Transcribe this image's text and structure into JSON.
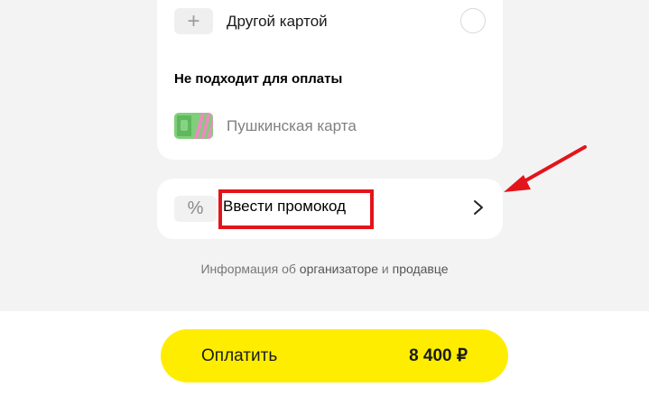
{
  "payment_methods": {
    "other_card_label": "Другой картой",
    "add_symbol": "+",
    "not_suitable_title": "Не подходит для оплаты",
    "pushkin_card_label": "Пушкинская карта"
  },
  "promo": {
    "icon_symbol": "%",
    "label": "Ввести промокод"
  },
  "info": {
    "prefix": "Информация об ",
    "organizer_link": "организаторе",
    "middle": " и ",
    "seller_link": "продавце"
  },
  "pay_button": {
    "label": "Оплатить",
    "amount": "8 400 ₽"
  },
  "colors": {
    "pay_button": "#ffed00",
    "highlight": "#e3141b",
    "background": "#f3f3f3"
  }
}
